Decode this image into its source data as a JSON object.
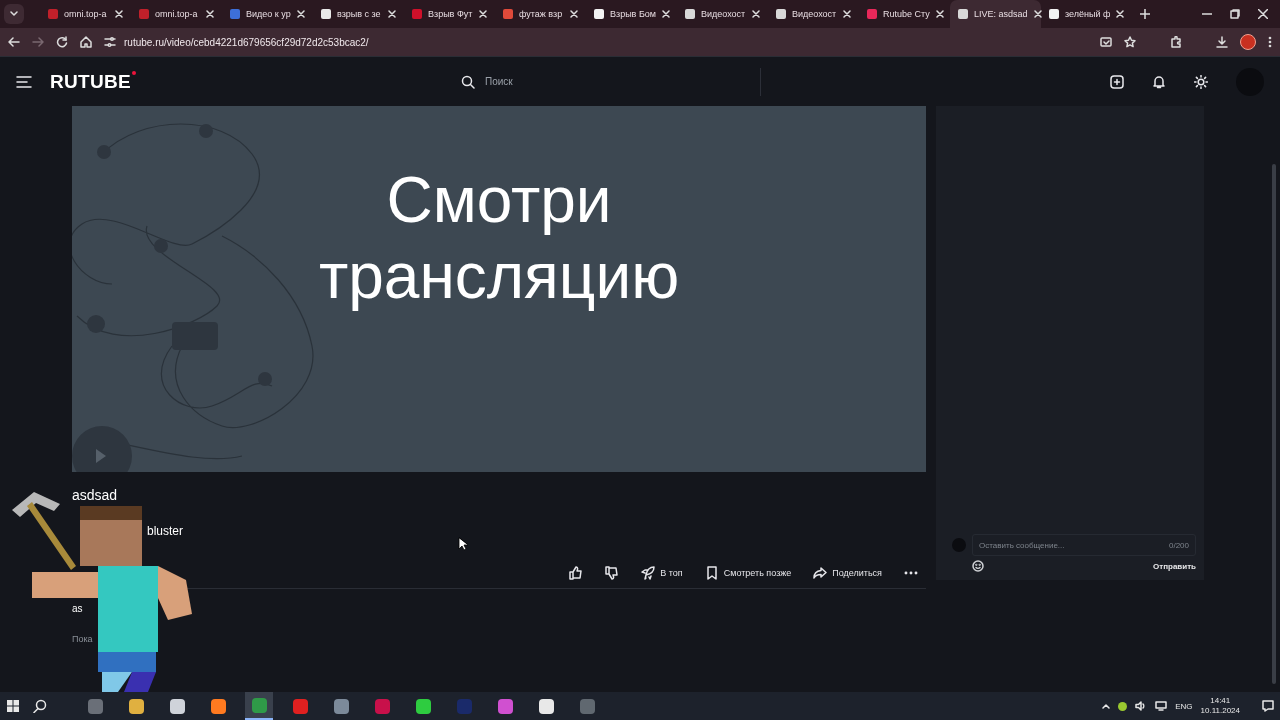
{
  "browser": {
    "tabs": [
      {
        "label": "omni.top-a",
        "kind": "omni",
        "selected": false
      },
      {
        "label": "omni.top-a",
        "kind": "omni",
        "selected": false
      },
      {
        "label": "Видео к ур",
        "kind": "swoosh",
        "selected": false
      },
      {
        "label": "взрыв с зе",
        "kind": "google",
        "selected": false
      },
      {
        "label": "Взрыв Фут",
        "kind": "pinterest",
        "selected": false
      },
      {
        "label": "футаж взр",
        "kind": "yandex",
        "selected": false
      },
      {
        "label": "Взрыв Бом",
        "kind": "is",
        "selected": false
      },
      {
        "label": "Видеохост",
        "kind": "rutube",
        "selected": false
      },
      {
        "label": "Видеохост",
        "kind": "rutube",
        "selected": false
      },
      {
        "label": "Rutube Сту",
        "kind": "studio",
        "selected": false
      },
      {
        "label": "LIVE: asdsad",
        "kind": "rutube",
        "selected": true
      },
      {
        "label": "зелёный ф",
        "kind": "is",
        "selected": false
      }
    ],
    "url": "rutube.ru/video/cebd4221d679656cf29d72d2c53bcac2/"
  },
  "header": {
    "logo": "RUTUBE",
    "search": {
      "placeholder": "Поиск"
    }
  },
  "player": {
    "headline": "Смотри трансляцию"
  },
  "video": {
    "title": "asdsad",
    "channel": "bluster",
    "author": "as",
    "show_more": "Пока"
  },
  "actions": [
    {
      "kind": "like"
    },
    {
      "kind": "dislike"
    },
    {
      "kind": "top",
      "label": "В топ"
    },
    {
      "kind": "later",
      "label": "Смотреть позже"
    },
    {
      "kind": "share",
      "label": "Поделиться"
    },
    {
      "kind": "more"
    }
  ],
  "chat": {
    "placeholder": "Оставить сообщение...",
    "counter": "0/200",
    "send": "Отправить"
  },
  "taskbar": {
    "apps": [
      {
        "color": "#6a6f78",
        "selected": false
      },
      {
        "color": "#e0b040",
        "selected": false
      },
      {
        "color": "#cfd3da",
        "selected": false
      },
      {
        "color": "#ff7a20",
        "selected": false
      },
      {
        "color": "#2f9a48",
        "selected": true
      },
      {
        "color": "#e02020",
        "selected": false
      },
      {
        "color": "#7c8a9a",
        "selected": false
      },
      {
        "color": "#c8104a",
        "selected": false
      },
      {
        "color": "#2ecc40",
        "selected": false
      },
      {
        "color": "#1a2a6a",
        "selected": false
      },
      {
        "color": "#d050d0",
        "selected": false
      },
      {
        "color": "#e8e8e8",
        "selected": false
      },
      {
        "color": "#606870",
        "selected": false
      }
    ],
    "lang": "ENG",
    "time": "14:41",
    "date": "10.11.2024"
  }
}
